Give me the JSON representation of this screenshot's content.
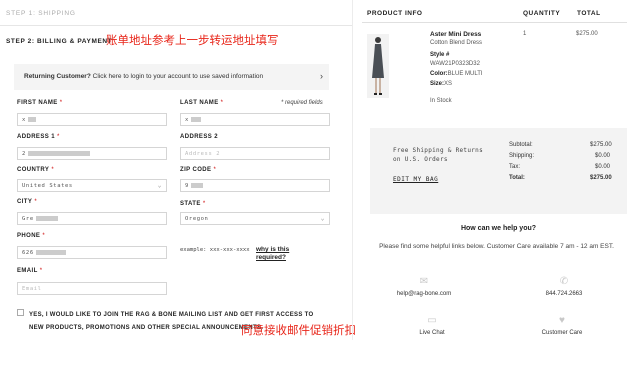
{
  "checkout": {
    "step1_label": "STEP 1: SHIPPING",
    "step2_label": "STEP 2: BILLING & PAYMENT",
    "annotation_billing": "账单地址参考上一步转运地址填写",
    "annotation_promo": "同意接收邮件促销折扣",
    "returning_label": "Returning Customer?",
    "returning_text": " Click here to login to your account to use saved information",
    "required_note": "* required fields",
    "req_mark": " *",
    "first_name": {
      "label": "FIRST NAME",
      "value": "x"
    },
    "last_name": {
      "label": "LAST NAME",
      "value": "x"
    },
    "address1": {
      "label": "ADDRESS 1",
      "value": "2"
    },
    "address2": {
      "label": "ADDRESS 2",
      "placeholder": "Address 2"
    },
    "country": {
      "label": "COUNTRY",
      "value": "United States"
    },
    "zip": {
      "label": "ZIP CODE",
      "value": "9"
    },
    "city": {
      "label": "CITY",
      "value": "Gre"
    },
    "state": {
      "label": "STATE",
      "value": "Oregon"
    },
    "phone": {
      "label": "PHONE",
      "value": "626"
    },
    "phone_example": "example: xxx-xxx-xxxx",
    "why_link": "why is this required?",
    "email": {
      "label": "EMAIL",
      "placeholder": "Email"
    },
    "promo_text": "YES, I WOULD LIKE TO JOIN THE RAG & BONE MAILING LIST AND GET FIRST ACCESS TO NEW PRODUCTS, PROMOTIONS AND OTHER SPECIAL ANNOUNCEMENTS."
  },
  "order": {
    "headers": {
      "product": "PRODUCT INFO",
      "quantity": "QUANTITY",
      "total": "TOTAL"
    },
    "item": {
      "name": "Aster Mini Dress",
      "material": "Cotton Blend Dress",
      "style_label": "Style #",
      "style": "WAW21P0323D32",
      "color_label": "Color:",
      "color": "BLUE MULTI",
      "size_label": "Size:",
      "size": "XS",
      "stock": "In Stock",
      "quantity": "1",
      "price": "$275.00"
    },
    "shipping_note": "Free Shipping & Returns on U.S. Orders",
    "edit_bag": "EDIT MY BAG",
    "summary": [
      {
        "label": "Subtotal:",
        "value": "$275.00"
      },
      {
        "label": "Shipping:",
        "value": "$0.00"
      },
      {
        "label": "Tax:",
        "value": "$0.00"
      },
      {
        "label": "Total:",
        "value": "$275.00"
      }
    ]
  },
  "help": {
    "title": "How can we help you?",
    "text": "Please find some helpful links below. Customer Care available 7 am - 12 am EST.",
    "email": "help@rag-bone.com",
    "phone": "844.724.2663",
    "chat": "Live Chat",
    "care": "Customer Care"
  },
  "colors": {
    "annotation": "#e8261a",
    "required": "#cc0000"
  }
}
